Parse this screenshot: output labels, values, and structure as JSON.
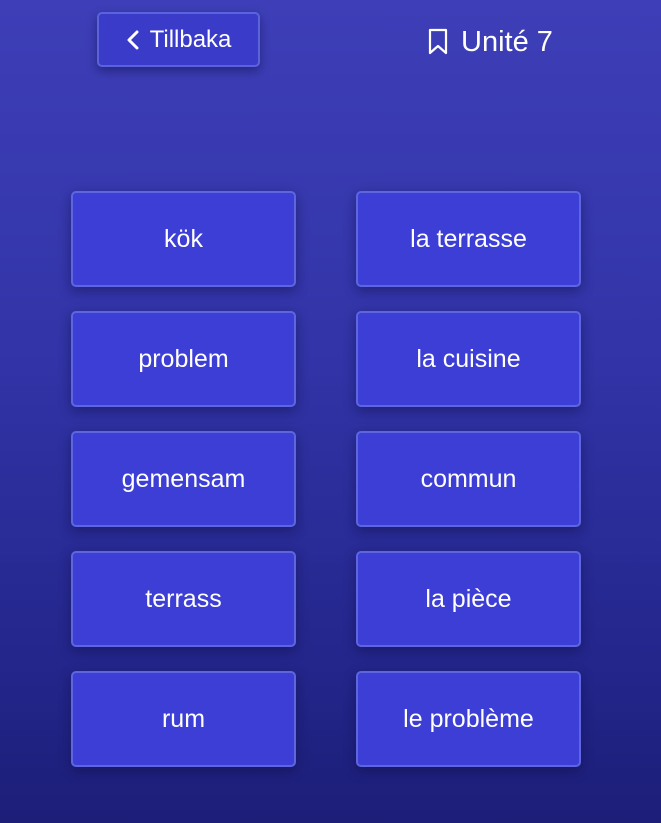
{
  "header": {
    "back_label": "Tillbaka",
    "back_icon": "chevron-left-icon",
    "unit_title": "Unité 7",
    "unit_icon": "bookmark-icon"
  },
  "cards": {
    "left": [
      "kök",
      "problem",
      "gemensam",
      "terrass",
      "rum"
    ],
    "right": [
      "la terrasse",
      "la cuisine",
      "commun",
      "la pièce",
      "le problème"
    ]
  },
  "colors": {
    "background_top": "#3e3fb8",
    "background_bottom": "#1c1e78",
    "card_fill": "#3c3ed6",
    "card_border": "#5d66df",
    "text": "#ffffff"
  }
}
